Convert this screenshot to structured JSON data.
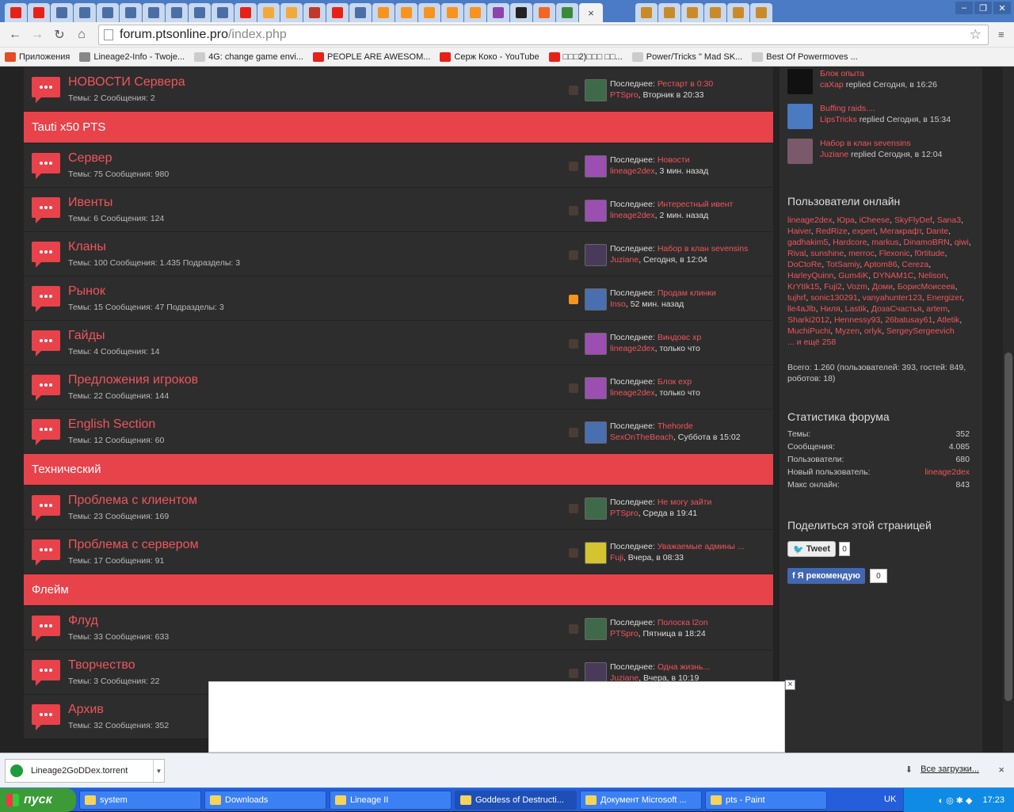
{
  "browser": {
    "tab_icons": [
      "yt",
      "yt",
      "ms",
      "ms",
      "ms",
      "ms",
      "ms",
      "ms",
      "ms",
      "ms",
      "yt",
      "sm",
      "sm",
      "yp",
      "yt",
      "ms",
      "a",
      "a",
      "a",
      "a",
      "a",
      "tbi",
      "amazon",
      "rss",
      "at"
    ],
    "tab_close": "×",
    "right_tabs": [
      "w",
      "g",
      "m",
      "w",
      "c",
      "c"
    ],
    "url_host": "forum.ptsonline.pro",
    "url_path": "/index.php",
    "bookmarks": [
      {
        "label": "Приложения",
        "color": "#e34c26"
      },
      {
        "label": "Lineage2-Info - Twoje...",
        "color": "#888888"
      },
      {
        "label": "4G: change game envi...",
        "color": "#cccccc"
      },
      {
        "label": "PEOPLE ARE AWESOM...",
        "color": "#e62117"
      },
      {
        "label": "Серж Коко - YouTube",
        "color": "#e62117"
      },
      {
        "label": "□□□2)□□□ □□...",
        "color": "#e62117"
      },
      {
        "label": "Power/Tricks \" Mad SK...",
        "color": "#cccccc"
      },
      {
        "label": "Best Of Powermoves ...",
        "color": "#cccccc"
      }
    ]
  },
  "labels": {
    "last": "Последнее: ",
    "topics": "Темы: ",
    "messages": " Сообщения: ",
    "subforums": "Подразделы: "
  },
  "forum": {
    "top_row": {
      "title": "НОВОСТИ Сервера",
      "stats": "Темы: 2 Сообщения: 2",
      "last_title": "Рестарт в 0:30",
      "last_user": "PTSpro",
      "last_time": ", Вторник в 20:33"
    },
    "categories": [
      {
        "name": "Tauti x50 PTS",
        "rows": [
          {
            "title": "Сервер",
            "stats": "Темы: 75 Сообщения: 980",
            "last_title": "Новости",
            "last_user": "lineage2dex",
            "last_time": ", 3 мин. назад"
          },
          {
            "title": "Ивенты",
            "stats": "Темы: 6 Сообщения: 124",
            "last_title": "Интерестный ивент",
            "last_user": "lineage2dex",
            "last_time": ", 2 мин. назад"
          },
          {
            "title": "Кланы",
            "stats": "Темы: 100 Сообщения: 1.435   Подразделы: 3",
            "last_title": "Набор в клан sevensins",
            "last_user": "Juziane",
            "last_time": ", Сегодня, в 12:04"
          },
          {
            "title": "Рынок",
            "stats": "Темы: 15 Сообщения: 47   Подразделы: 3",
            "last_title": "Продам клинки",
            "last_user": "Inso",
            "last_time": ", 52 мин. назад"
          },
          {
            "title": "Гайды",
            "stats": "Темы: 4 Сообщения: 14",
            "last_title": "Виндовс xp",
            "last_user": "lineage2dex",
            "last_time": ", только что"
          },
          {
            "title": "Предложения игроков",
            "stats": "Темы: 22 Сообщения: 144",
            "last_title": "Блок exp",
            "last_user": "lineage2dex",
            "last_time": ", только что"
          },
          {
            "title": "English Section",
            "stats": "Темы: 12 Сообщения: 60",
            "last_title": "Thehorde",
            "last_user": "SexOnTheBeach",
            "last_time": ", Суббота в 15:02"
          }
        ]
      },
      {
        "name": "Технический",
        "rows": [
          {
            "title": "Проблема с клиентом",
            "stats": "Темы: 23 Сообщения: 169",
            "last_title": "Не могу зайти",
            "last_user": "PTSpro",
            "last_time": ", Среда в 19:41"
          },
          {
            "title": "Проблема с сервером",
            "stats": "Темы: 17 Сообщения: 91",
            "last_title": "Уважаемые админы ...",
            "last_user": "Fuji",
            "last_time": ", Вчера, в 08:33"
          }
        ]
      },
      {
        "name": "Флейм",
        "rows": [
          {
            "title": "Флуд",
            "stats": "Темы: 33 Сообщения: 633",
            "last_title": "Полоска l2on",
            "last_user": "PTSpro",
            "last_time": ", Пятница в 18:24"
          },
          {
            "title": "Творчество",
            "stats": "Темы: 3 Сообщения: 22",
            "last_title": "Одна жизнь...",
            "last_user": "Juziane",
            "last_time": ", Вчера, в 10:19"
          },
          {
            "title": "Архив",
            "stats": "Темы: 32 Сообщения: 352",
            "last_title": "",
            "last_user": "",
            "last_time": ""
          }
        ]
      }
    ]
  },
  "sidebar": {
    "activity": [
      {
        "title": "Блок опыта",
        "user": "caXap",
        "text": " replied Сегодня, в 16:26"
      },
      {
        "title": "Buffing raids....",
        "user": "LipsTricks",
        "text": " replied Сегодня, в 15:34"
      },
      {
        "title": "Набор в клан sevensins",
        "user": "Juziane",
        "text": " replied Сегодня, в 12:04"
      }
    ],
    "online_title": "Пользователи онлайн",
    "online_users": [
      "lineage2dex",
      "Юра",
      "iCheese",
      "SkyFlyDef",
      "Sana3",
      "Haiver",
      "RedRize",
      "expert",
      "Мегакрафт",
      "Dante",
      "gadhakim5",
      "Hardcore",
      "markus",
      "DinamoBRN",
      "qiwi",
      "Rival",
      "sunshine",
      "merroc",
      "Flexonic",
      "f0rtitude",
      "DoCtoRe",
      "TotSamiy",
      "Aptom86",
      "Cereza",
      "HarleyQuinn",
      "Gum4iK",
      "DYNAM1C",
      "Nelison",
      "KrYtIk15",
      "Fuji2",
      "Vozm",
      "Доми",
      "БорисМоисеев",
      "tujhrf",
      "sonic130291",
      "vanyahunter123",
      "Energizer",
      "lle4aJlb",
      "Ниля",
      "Lastik",
      "ДозаСчастья",
      "artem",
      "Sharki2012",
      "Hennessy93",
      "26batusay61",
      "Atletik",
      "MuchiPuchi",
      "Myzen",
      "orlyk",
      "SergeySergeevich"
    ],
    "online_more": "... и ещё 258",
    "online_total": "Всего: 1.260 (пользователей: 393, гостей: 849, роботов: 18)",
    "stats_title": "Статистика форума",
    "stats": [
      {
        "label": "Темы:",
        "value": "352"
      },
      {
        "label": "Сообщения:",
        "value": "4.085"
      },
      {
        "label": "Пользователи:",
        "value": "680"
      },
      {
        "label": "Новый пользователь:",
        "value": "lineage2dex"
      },
      {
        "label": "Макс онлайн:",
        "value": "843"
      }
    ],
    "share_title": "Поделиться этой страницей",
    "tweet_label": "Tweet",
    "tweet_count": "0",
    "fb_label": "Я рекомендую",
    "fb_count": "0"
  },
  "downloads": {
    "file": "Lineage2GoDDex.torrent",
    "all_label": "Все загрузки...",
    "close": "×"
  },
  "taskbar": {
    "start": "пуск",
    "tasks": [
      "system",
      "Downloads",
      "Lineage II",
      "Goddess of Destructi...",
      "Документ Microsoft ...",
      "pts - Paint"
    ],
    "lang": "UK",
    "time": "17:23"
  },
  "colors": {
    "accent": "#e8424b",
    "link": "#f0555d",
    "bg": "#232323",
    "panel": "#2d2d2d"
  }
}
